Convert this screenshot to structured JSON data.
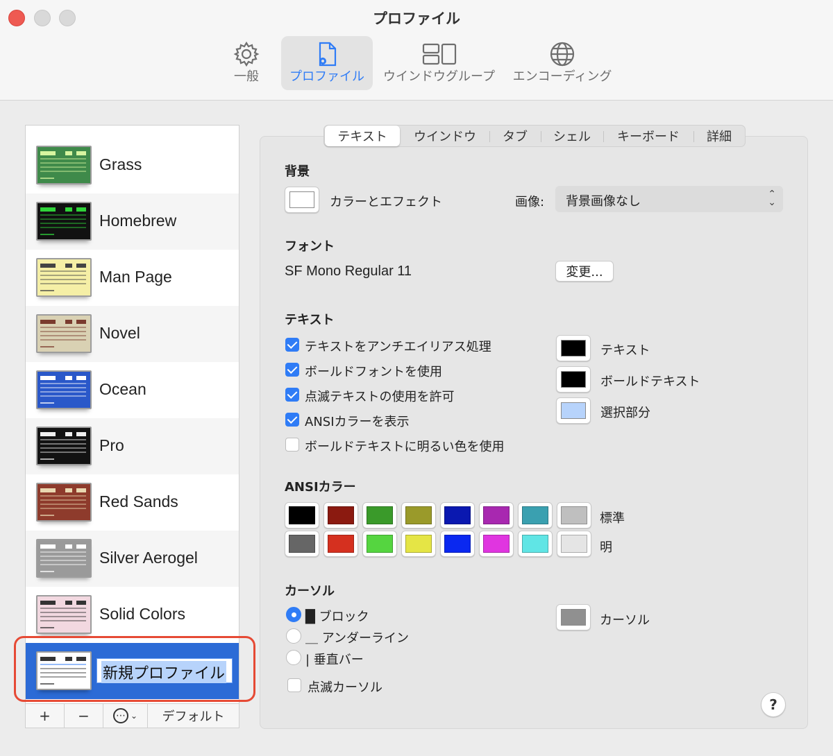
{
  "window": {
    "title": "プロファイル"
  },
  "toolbar": {
    "items": [
      {
        "label": "一般",
        "icon": "gear-icon"
      },
      {
        "label": "プロファイル",
        "icon": "profile-doc-icon"
      },
      {
        "label": "ウインドウグループ",
        "icon": "window-group-icon"
      },
      {
        "label": "エンコーディング",
        "icon": "globe-icon"
      }
    ],
    "active": "プロファイル"
  },
  "profiles": [
    {
      "name": "Grass",
      "bg": "#3f8a4a",
      "hd": "#d7f5a0"
    },
    {
      "name": "Homebrew",
      "bg": "#111111",
      "hd": "#2fd33a"
    },
    {
      "name": "Man Page",
      "bg": "#f5efa6",
      "hd": "#444444"
    },
    {
      "name": "Novel",
      "bg": "#d9d1b3",
      "hd": "#7a3b2e"
    },
    {
      "name": "Ocean",
      "bg": "#2a58c9",
      "hd": "#ffffff"
    },
    {
      "name": "Pro",
      "bg": "#121212",
      "hd": "#f0f0f0"
    },
    {
      "name": "Red Sands",
      "bg": "#8e3b2c",
      "hd": "#e9d7b0"
    },
    {
      "name": "Silver Aerogel",
      "bg": "#9a9a9a",
      "hd": "#ffffff"
    },
    {
      "name": "Solid Colors",
      "bg": "#f2d8e0",
      "hd": "#333333"
    }
  ],
  "new_profile": {
    "name": "新規プロファイル"
  },
  "sidebar_actions": {
    "add": "+",
    "remove": "−",
    "more": "⋯",
    "default": "デフォルト"
  },
  "tabs": [
    "テキスト",
    "ウインドウ",
    "タブ",
    "シェル",
    "キーボード",
    "詳細"
  ],
  "active_tab": "テキスト",
  "background": {
    "heading": "背景",
    "color_label": "カラーとエフェクト",
    "image_label": "画像:",
    "image_value": "背景画像なし"
  },
  "font": {
    "heading": "フォント",
    "value": "SF Mono Regular 11",
    "change_button": "変更..."
  },
  "text": {
    "heading": "テキスト",
    "options": [
      {
        "label": "テキストをアンチエイリアス処理",
        "checked": true
      },
      {
        "label": "ボールドフォントを使用",
        "checked": true
      },
      {
        "label": "点滅テキストの使用を許可",
        "checked": true
      },
      {
        "label": "ANSIカラーを表示",
        "checked": true
      },
      {
        "label": "ボールドテキストに明るい色を使用",
        "checked": false
      }
    ],
    "colors": [
      {
        "label": "テキスト",
        "color": "#000000"
      },
      {
        "label": "ボールドテキスト",
        "color": "#000000"
      },
      {
        "label": "選択部分",
        "color": "#b7d3fb"
      }
    ]
  },
  "ansi": {
    "heading": "ANSIカラー",
    "normal_label": "標準",
    "bright_label": "明",
    "normal": [
      "#000000",
      "#8b1a10",
      "#3a9a2a",
      "#9a9a2a",
      "#0a18b0",
      "#a828b0",
      "#3aa0b0",
      "#bfbfbf"
    ],
    "bright": [
      "#666666",
      "#d5301f",
      "#55d540",
      "#e5e545",
      "#0a28f0",
      "#e035e0",
      "#60e5e5",
      "#e5e5e5"
    ]
  },
  "cursor": {
    "heading": "カーソル",
    "options": [
      {
        "label": "█ ブロック",
        "selected": true
      },
      {
        "label": "＿ アンダーライン",
        "selected": false
      },
      {
        "label": "| 垂直バー",
        "selected": false
      }
    ],
    "blink_label": "点滅カーソル",
    "color_label": "カーソル",
    "color": "#909090"
  },
  "help": "?"
}
